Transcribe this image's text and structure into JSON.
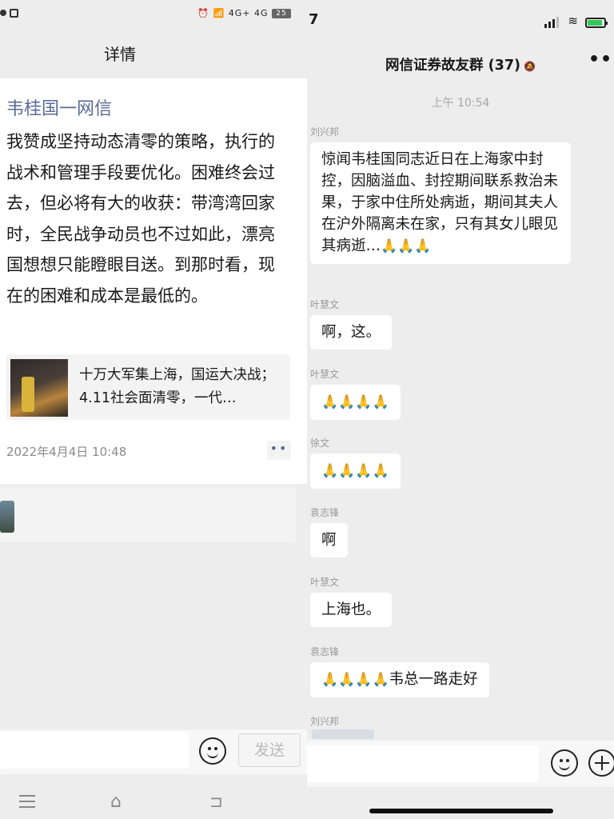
{
  "left": {
    "status": {
      "icons_text": "⏰ 📶 4G+ 4G",
      "battery": "25"
    },
    "title": "详情",
    "post": {
      "author": "韦桂国一网信",
      "body": "我赞成坚持动态清零的策略，执行的战术和管理手段要优化。困难终会过去，但必将有大的收获：带湾湾回家时，全民战争动员也不过如此，漂亮国想想只能瞪眼目送。到那时看，现在的困难和成本是最低的。",
      "link_title": "十万大军集上海，国运大决战；4.11社会面清零，一代…",
      "date": "2022年4月4日 10:48",
      "more": "••"
    },
    "input": {
      "placeholder": "",
      "send_label": "发送"
    },
    "nav": {
      "home": "⌂",
      "back": "⊐"
    }
  },
  "right": {
    "status": {
      "time": "7"
    },
    "chat_title": "网信证券故友群 (37)",
    "mute": "🔕",
    "more": "•••",
    "timestamp": "上午 10:54",
    "messages": [
      {
        "sender": "刘兴邦",
        "text": "惊闻韦桂国同志近日在上海家中封控，因脑溢血、封控期间联系救治未果，于家中住所处病逝，期间其夫人在沪外隔离未在家，只有其女儿眼见其病逝…",
        "pray": "🙏🙏🙏"
      },
      {
        "sender": "叶慧文",
        "text": "啊，这。"
      },
      {
        "sender": "叶慧文",
        "pray": "🙏🙏🙏🙏"
      },
      {
        "sender": "徐文",
        "pray": "🙏🙏🙏🙏"
      },
      {
        "sender": "袁志锋",
        "text": "啊"
      },
      {
        "sender": "叶慧文",
        "text": "上海也。"
      },
      {
        "sender": "袁志锋",
        "pray": "🙏🙏🙏🙏",
        "text": "韦总一路走好"
      },
      {
        "sender": "刘兴邦"
      }
    ]
  }
}
